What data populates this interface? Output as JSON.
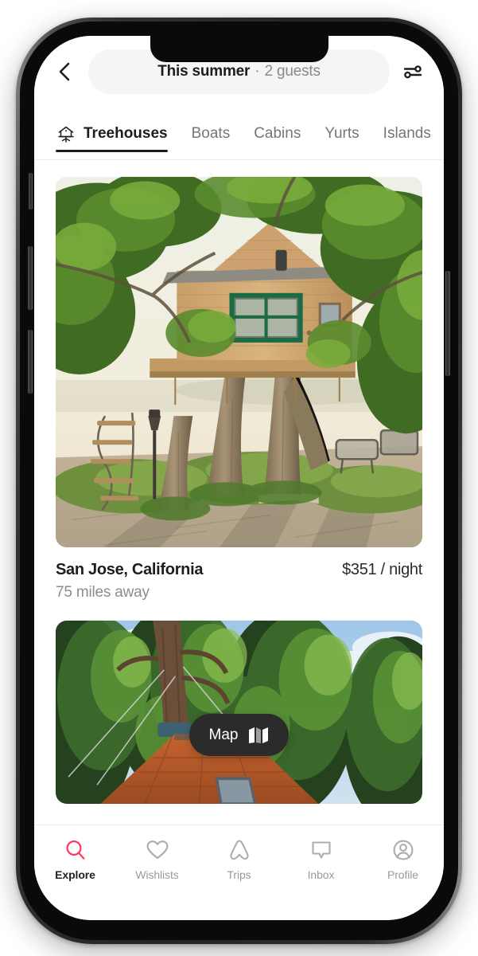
{
  "app": {
    "brand_color": "#FF385C",
    "accent_dark": "#222222"
  },
  "topbar": {
    "back_icon": "chevron-left-icon",
    "search": {
      "main_text": "This summer",
      "separator": "·",
      "sub_text": "2 guests"
    },
    "filter_icon": "sliders-filter-icon"
  },
  "tabs": [
    {
      "label": "Treehouses",
      "icon": "treehouse-icon",
      "active": true
    },
    {
      "label": "Boats",
      "icon": "",
      "active": false
    },
    {
      "label": "Cabins",
      "icon": "",
      "active": false
    },
    {
      "label": "Yurts",
      "icon": "",
      "active": false
    },
    {
      "label": "Islands",
      "icon": "",
      "active": false
    }
  ],
  "listings": [
    {
      "location": "San Jose, California",
      "price": "$351 / night",
      "distance": "75 miles away",
      "photo_alt": "wooden-treehouse-in-oak-tree"
    },
    {
      "location": "",
      "price": "",
      "distance": "",
      "photo_alt": "treehouse-roof-in-conifer-forest"
    }
  ],
  "map_button": {
    "label": "Map",
    "icon": "folded-map-icon"
  },
  "bottom_nav": [
    {
      "label": "Explore",
      "icon": "search-icon",
      "active": true
    },
    {
      "label": "Wishlists",
      "icon": "heart-icon",
      "active": false
    },
    {
      "label": "Trips",
      "icon": "airbnb-belo-icon",
      "active": false
    },
    {
      "label": "Inbox",
      "icon": "chat-bubble-icon",
      "active": false
    },
    {
      "label": "Profile",
      "icon": "user-circle-icon",
      "active": false
    }
  ]
}
